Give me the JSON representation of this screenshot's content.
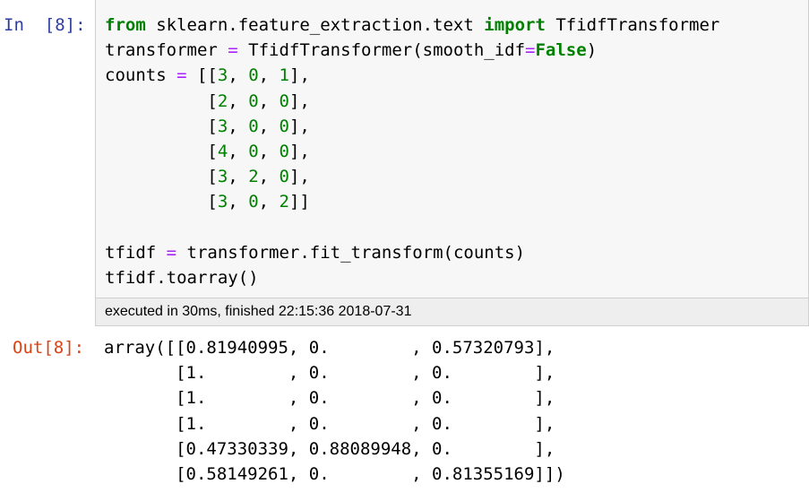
{
  "cell": {
    "in_prompt": "In  [8]:",
    "out_prompt": "Out[8]:",
    "execution_info": "executed in 30ms, finished 22:15:36 2018-07-31",
    "code": {
      "l1_kw1": "from",
      "l1_mod": " sklearn.feature_extraction.text ",
      "l1_kw2": "import",
      "l1_name": " TfidfTransformer",
      "l2_a": "transformer ",
      "l2_op": "=",
      "l2_b": " TfidfTransformer(smooth_idf",
      "l2_op2": "=",
      "l2_kw": "False",
      "l2_c": ")",
      "l3_a": "counts ",
      "l3_op": "=",
      "l3_b": " [[",
      "rows": [
        [
          "3",
          "0",
          "1"
        ],
        [
          "2",
          "0",
          "0"
        ],
        [
          "3",
          "0",
          "0"
        ],
        [
          "4",
          "0",
          "0"
        ],
        [
          "3",
          "2",
          "0"
        ],
        [
          "3",
          "0",
          "2"
        ]
      ],
      "l10_a": "tfidf ",
      "l10_op": "=",
      "l10_b": " transformer.fit_transform(counts)",
      "l11": "tfidf.toarray()"
    },
    "output_lines": [
      "array([[0.81940995, 0.        , 0.57320793],",
      "       [1.        , 0.        , 0.        ],",
      "       [1.        , 0.        , 0.        ],",
      "       [1.        , 0.        , 0.        ],",
      "       [0.47330339, 0.88089948, 0.        ],",
      "       [0.58149261, 0.        , 0.81355169]])"
    ]
  }
}
